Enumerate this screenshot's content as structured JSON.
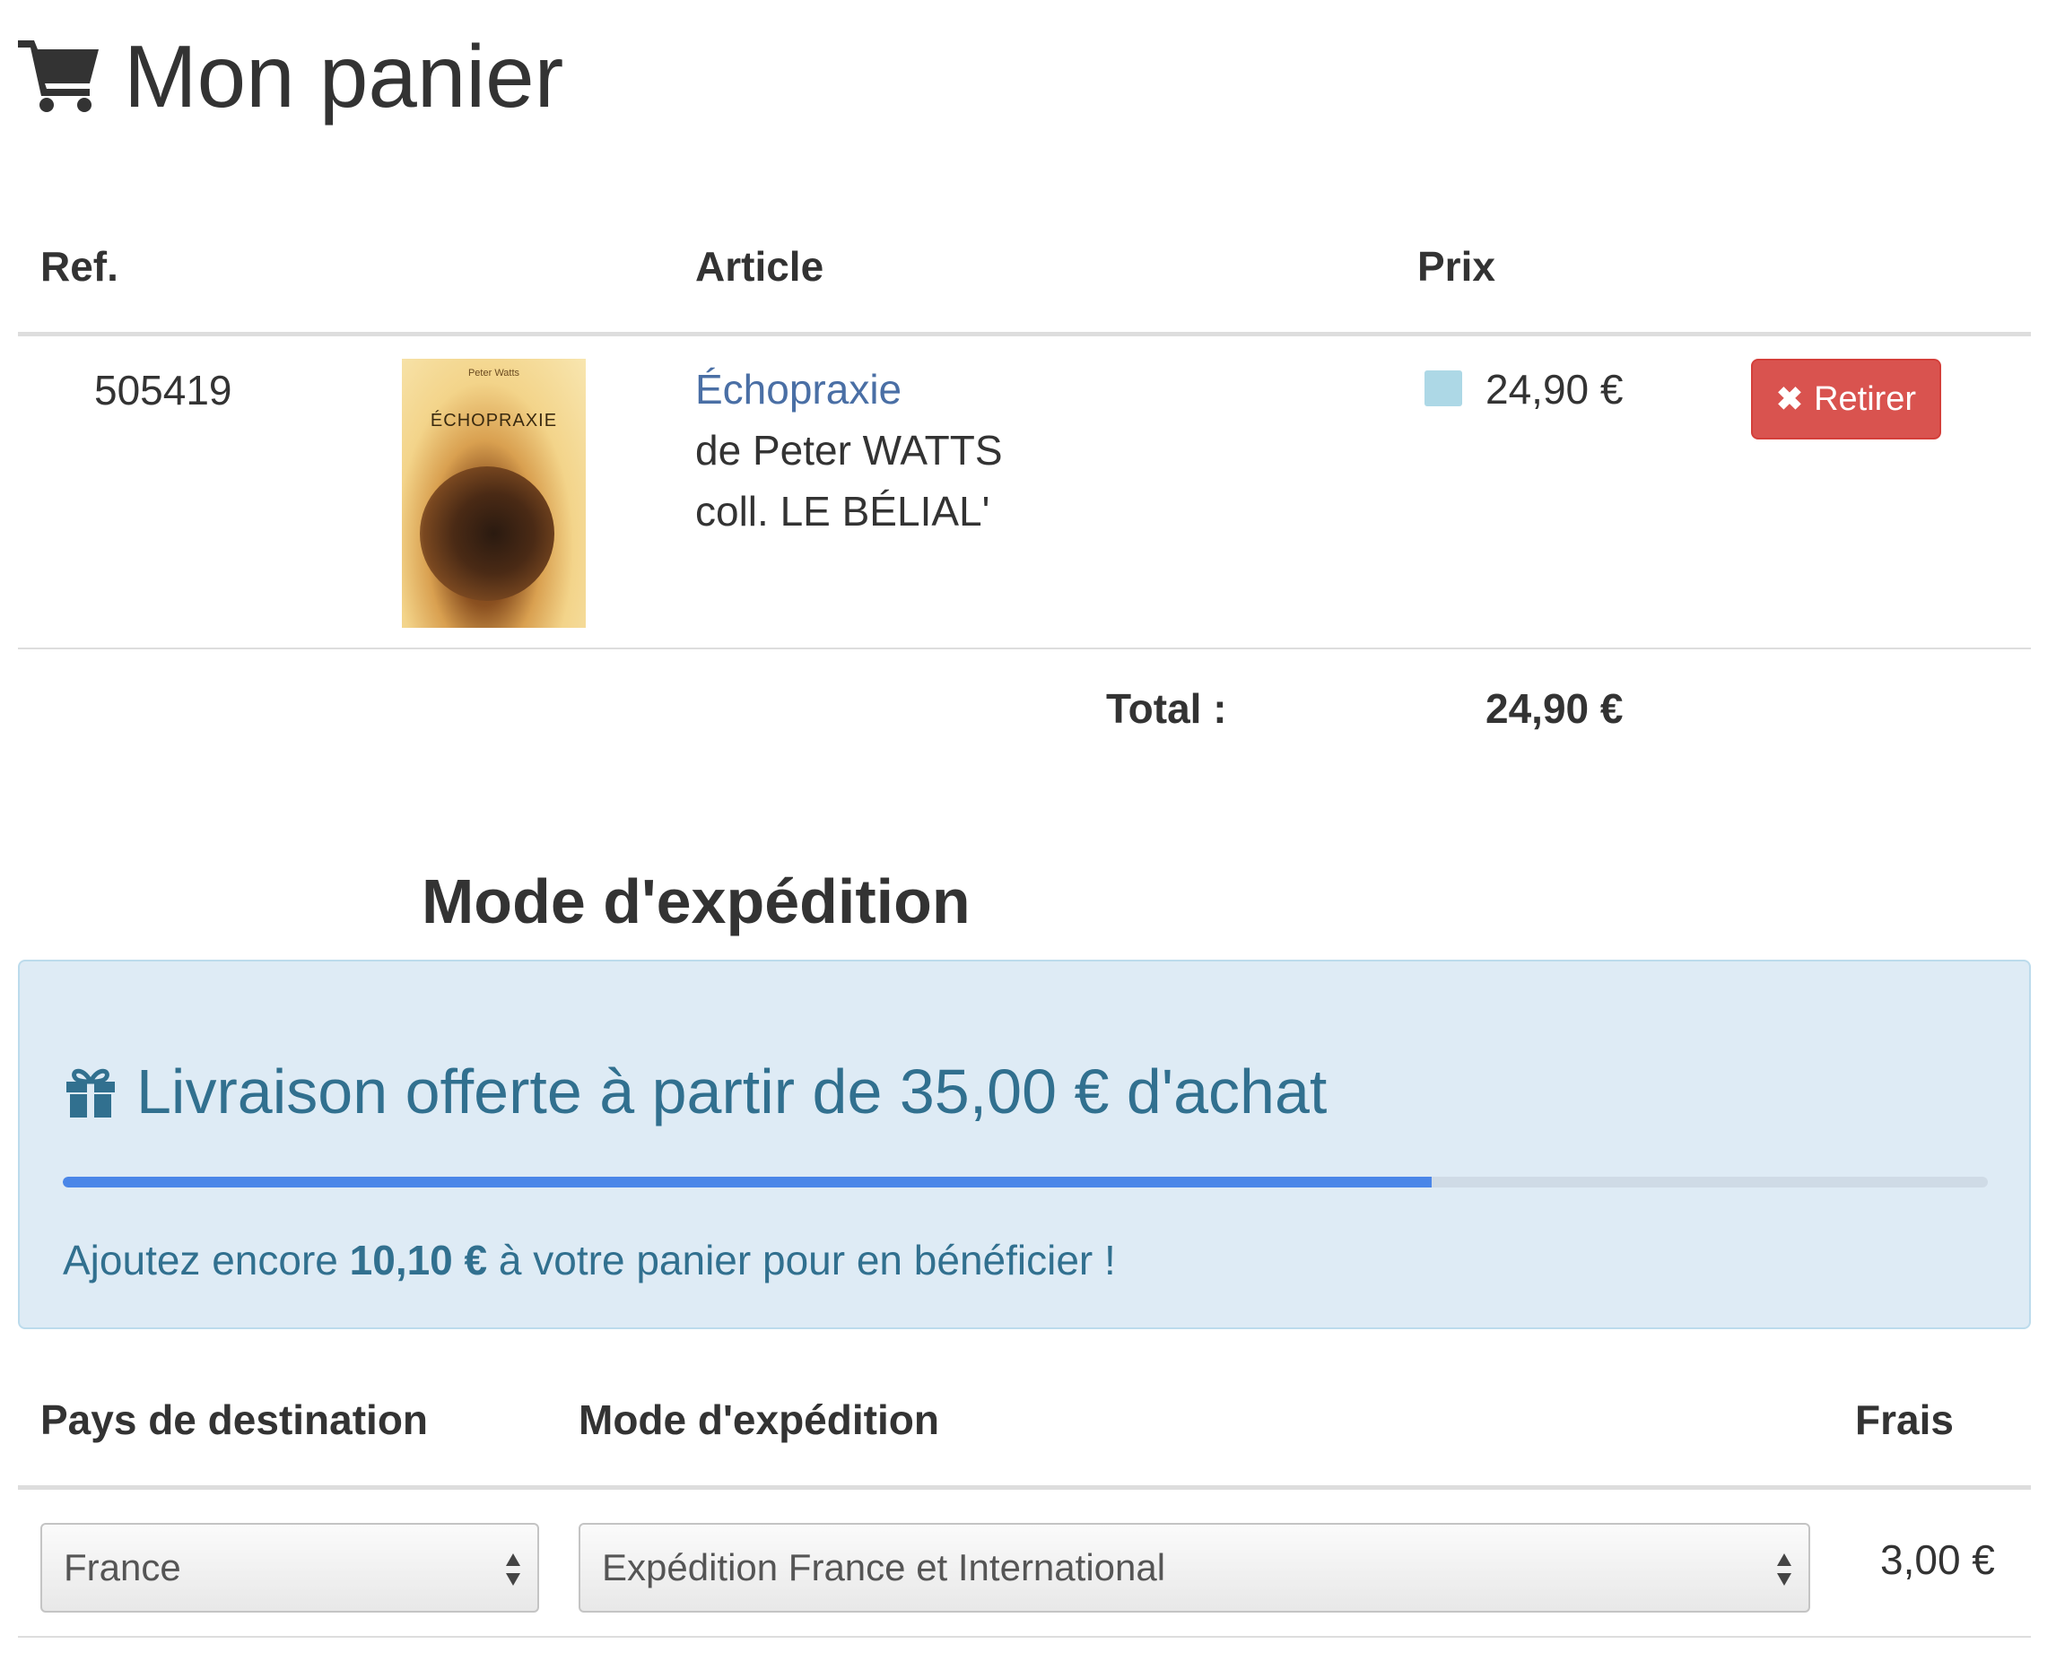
{
  "page": {
    "title": "Mon panier",
    "cart_icon": "shopping-cart-icon"
  },
  "cart": {
    "headers": {
      "ref": "Ref.",
      "article": "Article",
      "price": "Prix"
    },
    "items": [
      {
        "ref": "505419",
        "cover": {
          "author": "Peter Watts",
          "title": "ÉCHOPRAXIE"
        },
        "title": "Échopraxie",
        "author_line": "de Peter WATTS",
        "collection_line": "coll. LE BÉLIAL'",
        "price": "24,90 €",
        "swatch_color": "#add8e6",
        "remove_label": "Retirer"
      }
    ],
    "total_label": "Total :",
    "total_value": "24,90 €"
  },
  "shipping": {
    "heading": "Mode d'expédition",
    "promo": {
      "icon": "gift-icon",
      "title": "Livraison offerte à partir de 35,00 € d'achat",
      "progress_fraction": 0.711,
      "message_before": "Ajoutez encore ",
      "message_amount": "10,10 €",
      "message_after": " à votre panier pour en bénéficier !",
      "progress_color": "#4a86e8"
    },
    "headers": {
      "country": "Pays de destination",
      "method": "Mode d'expédition",
      "fees": "Frais"
    },
    "country_selected": "France",
    "method_selected": "Expédition France et International",
    "fee": "3,00 €"
  },
  "colors": {
    "link": "#4a6fa5",
    "danger": "#d9534f",
    "info_bg": "#deebf5",
    "info_text": "#31708f"
  }
}
